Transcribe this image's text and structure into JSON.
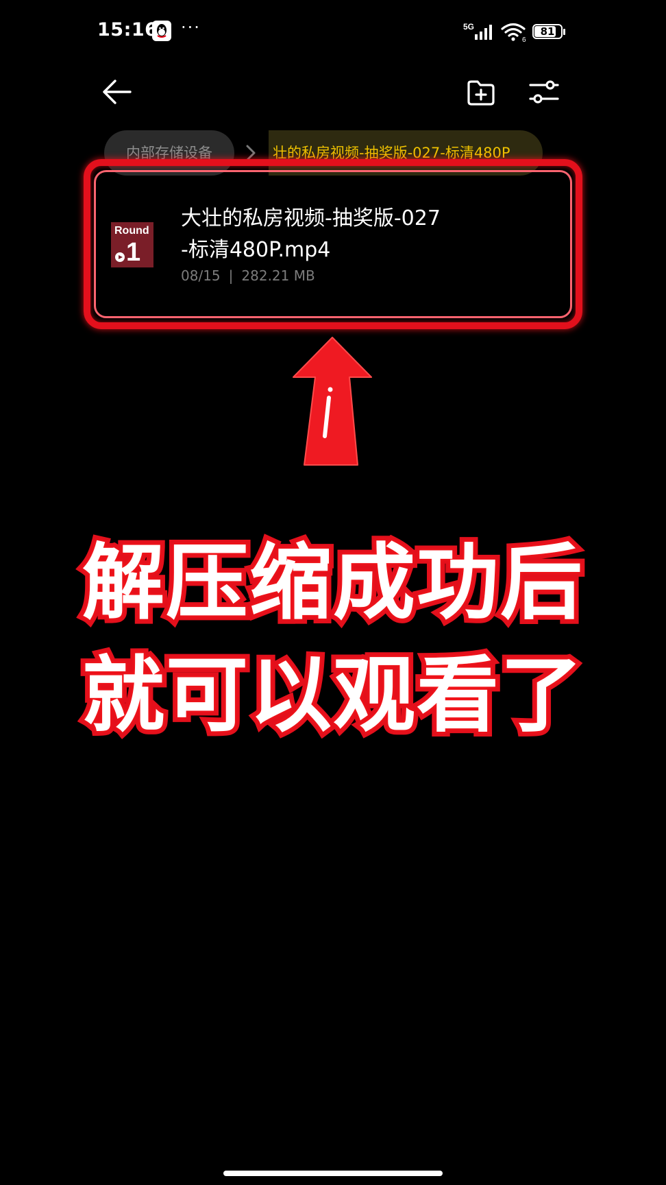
{
  "status_bar": {
    "time": "15:16",
    "more_indicator": "···",
    "network": "5G",
    "wifi_sub": "6",
    "battery_level": "81",
    "battery_fraction": 0.81,
    "icons": [
      "qq-app-icon",
      "signal-icon",
      "wifi-icon",
      "battery-icon"
    ]
  },
  "toolbar": {
    "back_icon": "arrow-left-icon",
    "new_folder_icon": "folder-plus-icon",
    "filter_icon": "sliders-icon"
  },
  "breadcrumb": {
    "root": "内部存储设备",
    "current": "壮的私房视频-抽奖版-027-标清480P"
  },
  "file": {
    "name": "大壮的私房视频-抽奖版-027-标清480P.mp4",
    "date": "08/15",
    "separator": "|",
    "size": "282.21 MB",
    "thumbnail": {
      "title": "Round",
      "number": "1"
    }
  },
  "overlay": {
    "line1": "解压缩成功后",
    "line2": "就可以观看了",
    "color": "#e3101c"
  },
  "colors": {
    "background": "#000000",
    "accent_breadcrumb": "#f0c200",
    "highlight": "#e3101c"
  }
}
